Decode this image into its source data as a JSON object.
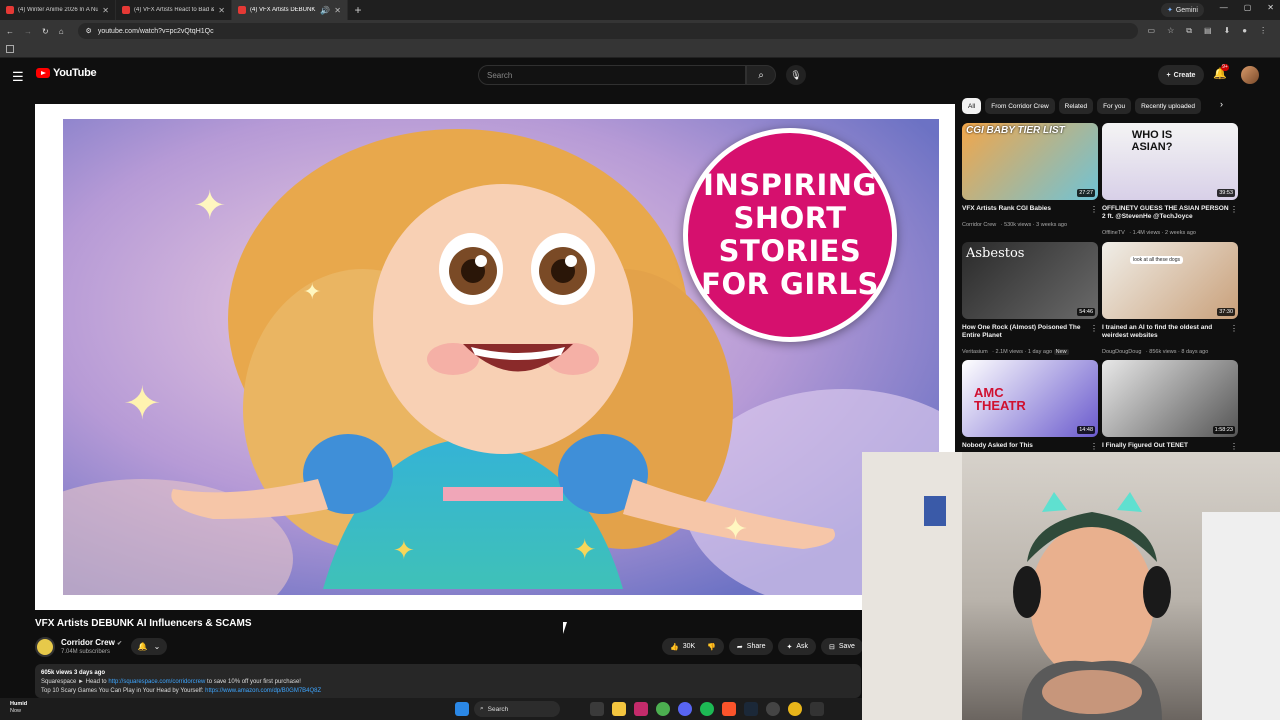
{
  "browser": {
    "tabs": [
      {
        "title": "(4) Winter Anime 2026 In A Nu",
        "active": false
      },
      {
        "title": "(4) VFX Artists React to Bad & C",
        "active": false
      },
      {
        "title": "(4) VFX Artists DEBUNK AI",
        "active": true
      }
    ],
    "gemini_label": "Gemini",
    "url": "youtube.com/watch?v=pc2vQtqH1Qc"
  },
  "youtube": {
    "logo_text": "YouTube",
    "search_placeholder": "Search",
    "create_label": "Create",
    "notification_count": "9+"
  },
  "video": {
    "thumbnail_text": [
      "INSPIRING",
      "SHORT",
      "STORIES",
      "FOR GIRLS"
    ],
    "title": "VFX Artists DEBUNK AI Influencers & SCAMS",
    "channel": "Corridor Crew",
    "subscribers": "7.04M subscribers",
    "like_count": "30K",
    "share_label": "Share",
    "ask_label": "Ask",
    "save_label": "Save",
    "views_date": "605k views  3 days ago",
    "desc_line1_pre": "Squarespace ► Head to ",
    "desc_line1_link": "http://squarespace.com/corridorcrew",
    "desc_line1_post": " to save 10% off your first purchase!",
    "desc_line2_pre": "Top 10 Scary Games You Can Play in Your Head by Yourself: ",
    "desc_line2_link": "https://www.amazon.com/dp/B0GM7B4Q8Z"
  },
  "filters": {
    "chips": [
      "All",
      "From Corridor Crew",
      "Related",
      "For you",
      "Recently uploaded"
    ]
  },
  "recommendations": [
    {
      "title": "VFX Artists Rank CGI Babies",
      "channel": "Corridor Crew",
      "meta": "530k views · 3 weeks ago",
      "duration": "27:27",
      "thumb_text": "CGI BABY TIER LIST"
    },
    {
      "title": "OFFLINETV GUESS THE ASIAN PERSON 2 ft. @StevenHe @TechJoyce",
      "channel": "OfflineTV",
      "meta": "1.4M views · 2 weeks ago",
      "duration": "39:53",
      "thumb_text": "WHO IS ASIAN?"
    },
    {
      "title": "How One Rock (Almost) Poisoned The Entire Planet",
      "channel": "Veritasium",
      "meta": "2.1M views · 1 day ago",
      "badge": "New",
      "duration": "54:46",
      "thumb_text": "Asbestos"
    },
    {
      "title": "I trained an AI to find the oldest and weirdest websites",
      "channel": "DougDougDoug",
      "meta": "856k views · 8 days ago",
      "duration": "37:30",
      "thumb_text": "look at all these dogs"
    },
    {
      "title": "Nobody Asked for This",
      "channel": "",
      "meta": "",
      "duration": "14:48",
      "thumb_text": "AMC THEATR"
    },
    {
      "title": "I Finally Figured Out TENET",
      "channel": "",
      "meta": "",
      "duration": "1:58:23",
      "thumb_text": ""
    }
  ],
  "taskbar": {
    "weather_title": "Humid",
    "weather_sub": "Now",
    "search_label": "Search"
  },
  "colors": {
    "brand": "#ff0000",
    "badge": "#d6106e",
    "link": "#3ea6ff"
  }
}
